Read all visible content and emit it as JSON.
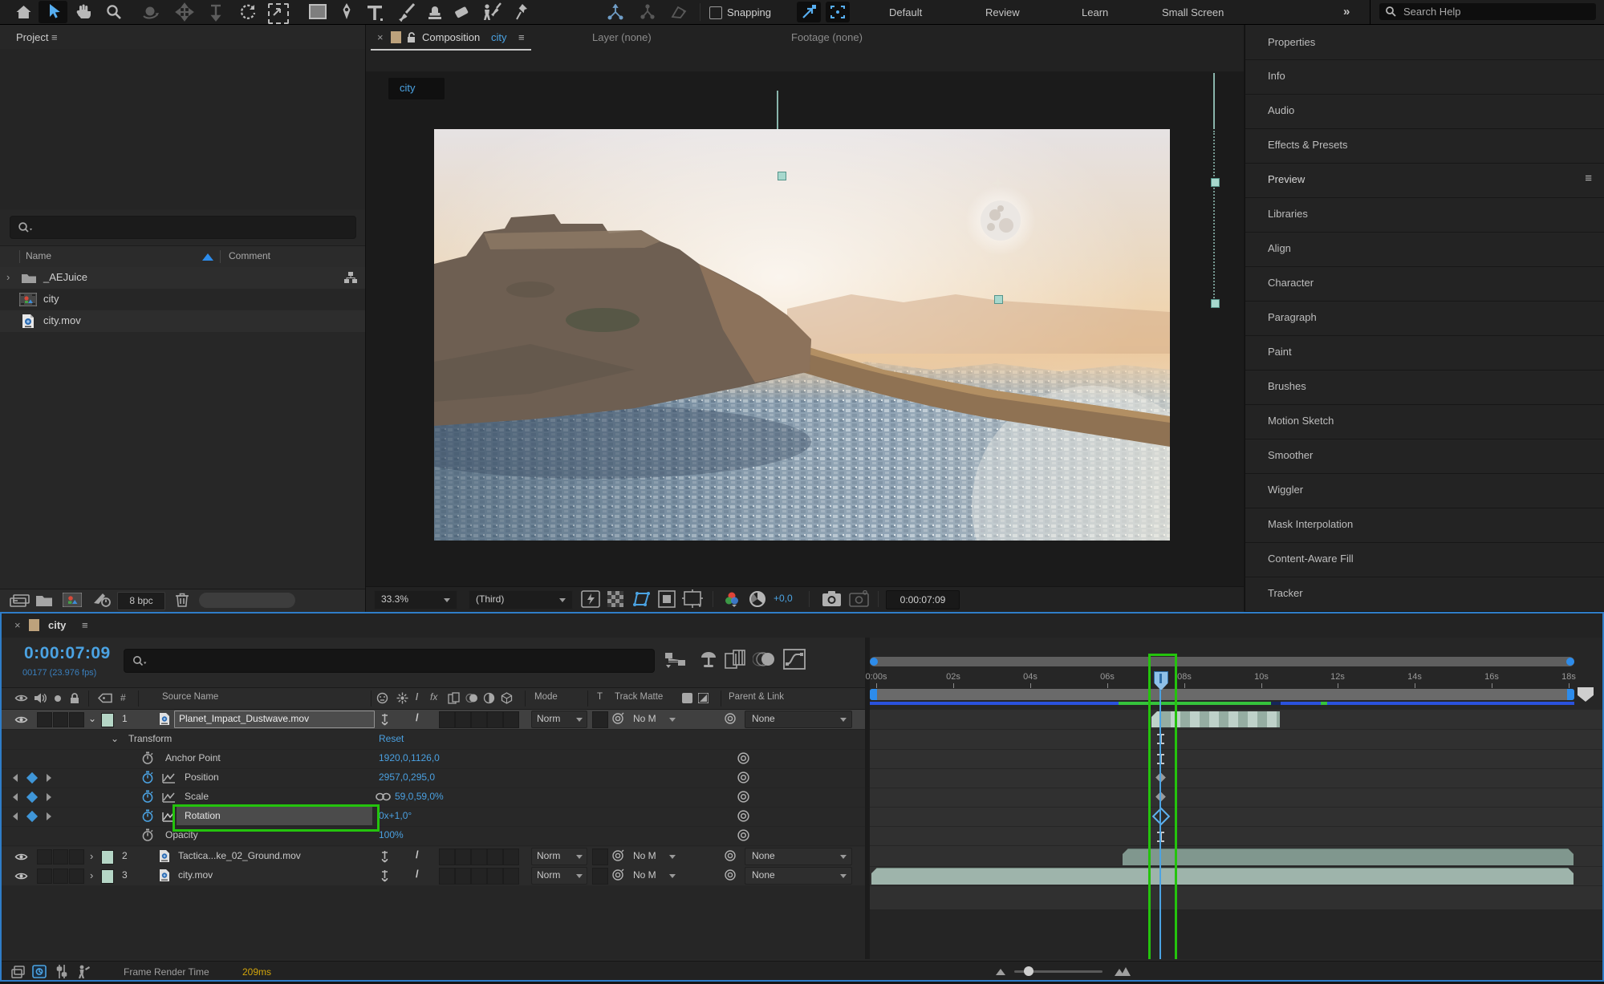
{
  "glyphs": {
    "close": "×",
    "menu": "≡",
    "chev_r": "›",
    "chev_d": "⌄",
    "hash": "#",
    "dbl_chev": "»",
    "slash": "/",
    "fx": "fx",
    "infinity": "∞",
    "at": "@"
  },
  "toolbar": {
    "snapping_label": "Snapping",
    "workspaces": [
      "Default",
      "Review",
      "Learn",
      "Small Screen"
    ],
    "search_placeholder": "Search Help"
  },
  "project": {
    "title": "Project",
    "columns": {
      "name": "Name",
      "comment": "Comment"
    },
    "items": [
      {
        "label": "_AEJuice",
        "type": "folder"
      },
      {
        "label": "city",
        "type": "composition"
      },
      {
        "label": "city.mov",
        "type": "footage"
      }
    ],
    "depth_label": "8 bpc"
  },
  "viewer": {
    "tab_comp_prefix": "Composition",
    "tab_comp_name": "city",
    "tab_layer": "Layer (none)",
    "tab_footage": "Footage (none)",
    "target_tab": "city",
    "zoom": "33.3%",
    "resolution": "(Third)",
    "exposure": "+0,0",
    "timecode": "0:00:07:09"
  },
  "sidebar": {
    "panels": [
      "Properties",
      "Info",
      "Audio",
      "Effects & Presets",
      "Preview",
      "Libraries",
      "Align",
      "Character",
      "Paragraph",
      "Paint",
      "Brushes",
      "Motion Sketch",
      "Smoother",
      "Wiggler",
      "Mask Interpolation",
      "Content-Aware Fill",
      "Tracker"
    ]
  },
  "timeline": {
    "tab": "city",
    "timecode": "0:00:07:09",
    "frame_info": "00177 (23.976 fps)",
    "columns": {
      "source_name": "Source Name",
      "mode": "Mode",
      "t": "T",
      "track_matte": "Track Matte",
      "parent": "Parent & Link",
      "num": "#"
    },
    "layers": [
      {
        "num": "1",
        "name": "Planet_Impact_Dustwave.mov",
        "mode": "Norm",
        "matte": "No M",
        "parent": "None"
      },
      {
        "num": "2",
        "name": "Tactica...ke_02_Ground.mov",
        "mode": "Norm",
        "matte": "No M",
        "parent": "None"
      },
      {
        "num": "3",
        "name": "city.mov",
        "mode": "Norm",
        "matte": "No M",
        "parent": "None"
      }
    ],
    "transform": {
      "group": "Transform",
      "reset": "Reset",
      "props": [
        {
          "label": "Anchor Point",
          "value": "1920,0,1126,0"
        },
        {
          "label": "Position",
          "value": "2957,0,295,0"
        },
        {
          "label": "Scale",
          "value": "59,0,59,0%"
        },
        {
          "label": "Rotation",
          "value": "0x+1,0°"
        },
        {
          "label": "Opacity",
          "value": "100%"
        }
      ]
    },
    "ruler": [
      "0:00s",
      "02s",
      "04s",
      "06s",
      "08s",
      "10s",
      "12s",
      "14s",
      "16s",
      "18s"
    ],
    "status": {
      "label": "Frame Render Time",
      "value": "209ms"
    }
  },
  "colors": {
    "accent_blue": "#3f96d8",
    "annotation_green": "#24c30d",
    "value_blue": "#4aa0e0",
    "render_yellow": "#d3a50b"
  }
}
